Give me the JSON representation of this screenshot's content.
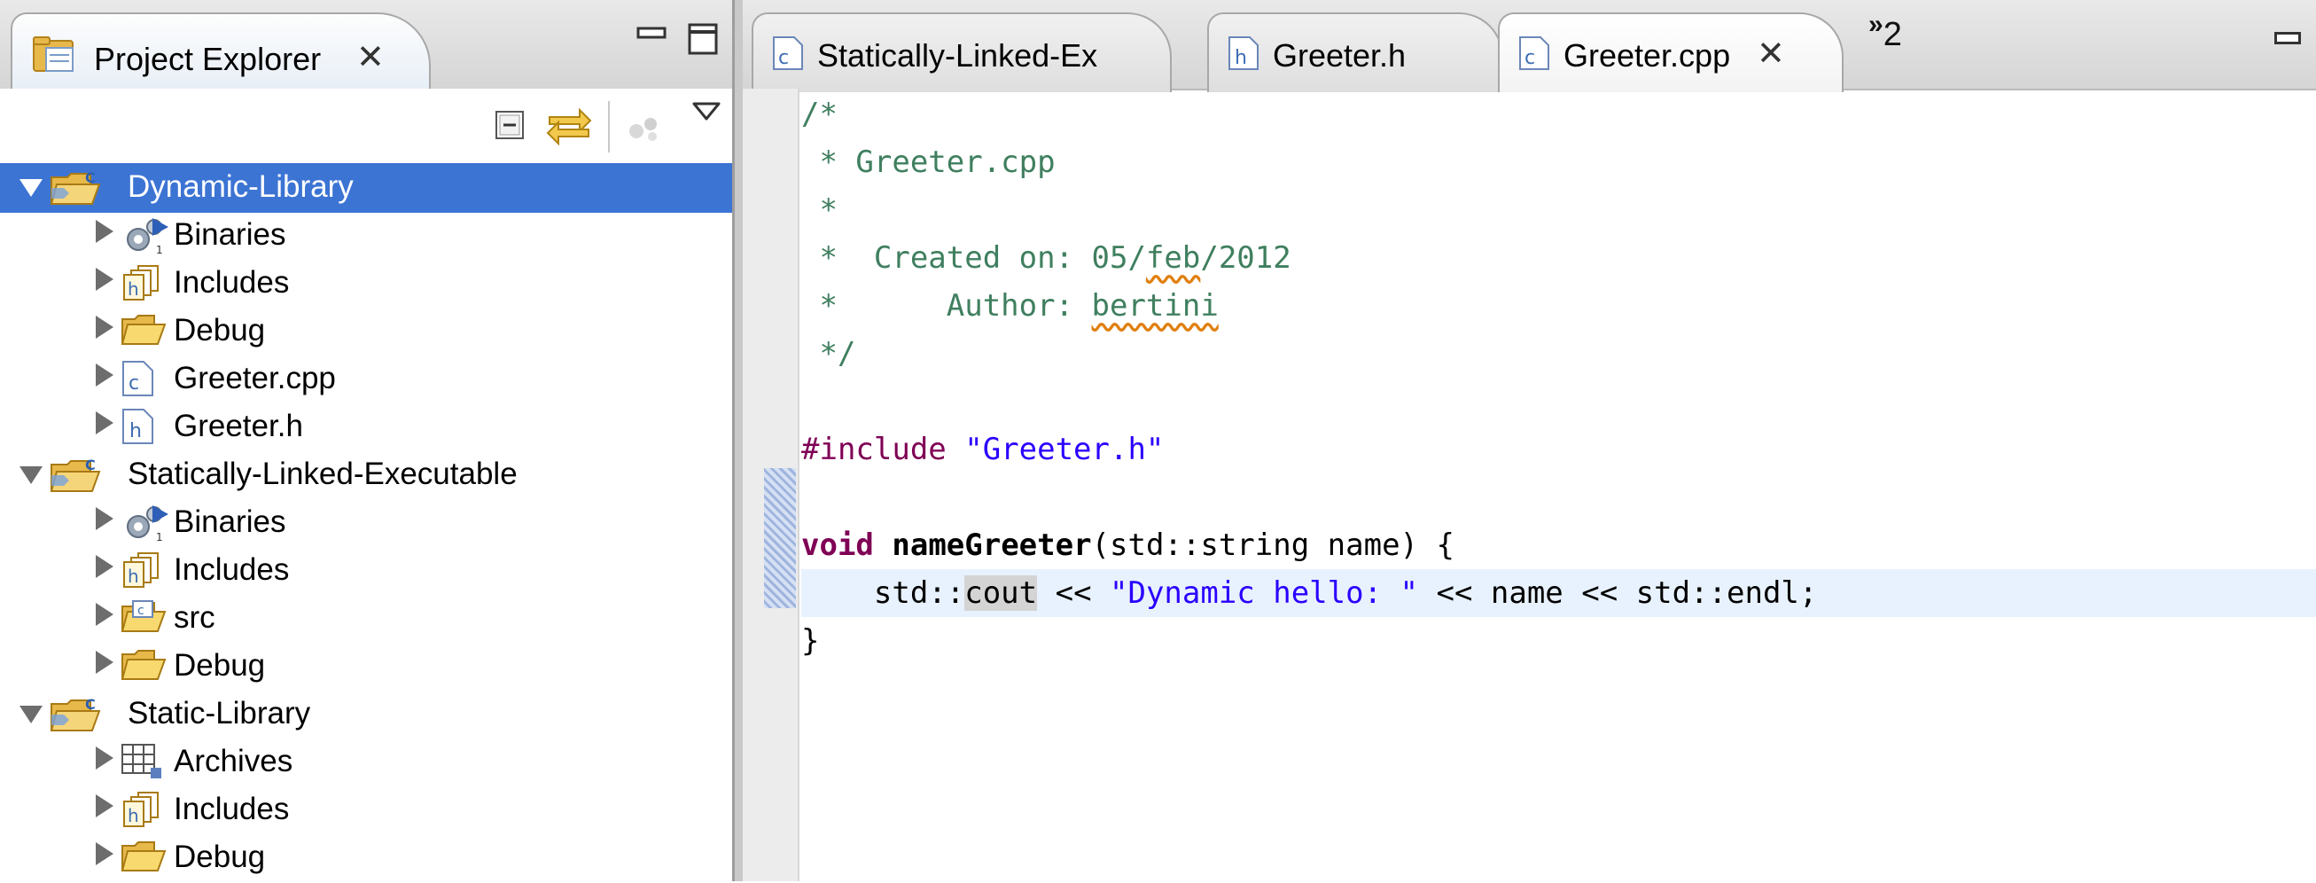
{
  "explorer": {
    "title": "Project Explorer",
    "close_glyph": "✕",
    "tree": [
      {
        "label": "Dynamic-Library",
        "level": 0,
        "expanded": true,
        "selected": true,
        "icon": "c-project-folder-icon"
      },
      {
        "label": "Binaries",
        "level": 1,
        "icon": "binaries-icon"
      },
      {
        "label": "Includes",
        "level": 1,
        "icon": "includes-icon"
      },
      {
        "label": "Debug",
        "level": 1,
        "icon": "folder-icon"
      },
      {
        "label": "Greeter.cpp",
        "level": 1,
        "icon": "c-file-icon"
      },
      {
        "label": "Greeter.h",
        "level": 1,
        "icon": "h-file-icon"
      },
      {
        "label": "Statically-Linked-Executable",
        "level": 0,
        "expanded": true,
        "icon": "c-project-folder-icon"
      },
      {
        "label": "Binaries",
        "level": 1,
        "icon": "binaries-icon"
      },
      {
        "label": "Includes",
        "level": 1,
        "icon": "includes-icon"
      },
      {
        "label": "src",
        "level": 1,
        "icon": "source-folder-icon"
      },
      {
        "label": "Debug",
        "level": 1,
        "icon": "folder-icon"
      },
      {
        "label": "Static-Library",
        "level": 0,
        "expanded": true,
        "icon": "c-project-folder-icon"
      },
      {
        "label": "Archives",
        "level": 1,
        "icon": "archives-icon"
      },
      {
        "label": "Includes",
        "level": 1,
        "icon": "includes-icon"
      },
      {
        "label": "Debug",
        "level": 1,
        "icon": "folder-icon"
      }
    ]
  },
  "editor": {
    "tabs": [
      {
        "label": "Statically-Linked-Ex",
        "icon": "c-file-icon",
        "active": false
      },
      {
        "label": "Greeter.h",
        "icon": "h-file-icon",
        "active": false
      },
      {
        "label": "Greeter.cpp",
        "icon": "c-file-icon",
        "active": true
      }
    ],
    "overflow_glyph": "»",
    "overflow_count": "2",
    "code": {
      "l1": "/*",
      "l2": " * Greeter.cpp",
      "l3": " *",
      "l4a": " *  Created on: 05/",
      "l4b": "feb",
      "l4c": "/2012",
      "l5a": " *      Author: ",
      "l5b": "bertini",
      "l6": " */",
      "l8a": "#include",
      "l8b": " \"Greeter.h\"",
      "l10a": "void",
      "l10b": " ",
      "l10c": "nameGreeter",
      "l10d": "(std::string name) {",
      "l11a": "    std::",
      "l11b": "cout",
      "l11c": " << ",
      "l11d": "\"Dynamic hello: \"",
      "l11e": " << name << std::endl;",
      "l12": "}"
    }
  },
  "colors": {
    "selection": "#3c74d4",
    "comment": "#3f7f5f",
    "keyword": "#7f0055",
    "string": "#2a00ff",
    "current_line": "#e8f2fe"
  }
}
